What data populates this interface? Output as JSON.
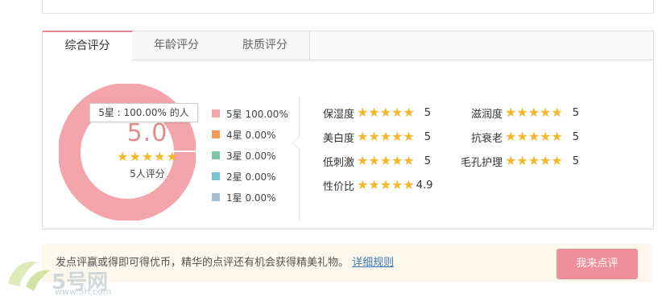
{
  "tabs": [
    {
      "label": "综合评分",
      "active": true
    },
    {
      "label": "年龄评分",
      "active": false
    },
    {
      "label": "肤质评分",
      "active": false
    }
  ],
  "overall": {
    "score": "5.0",
    "people": "5人评分",
    "stars": 5,
    "tooltip": "5星 : 100.00% 的人",
    "ring_color": "#f4a4ab"
  },
  "legend": [
    {
      "label": "5星 100.00%",
      "color": "#f4a4ab"
    },
    {
      "label": "4星 0.00%",
      "color": "#f79a58"
    },
    {
      "label": "3星 0.00%",
      "color": "#7fc6a6"
    },
    {
      "label": "2星 0.00%",
      "color": "#74c4d4"
    },
    {
      "label": "1星 0.00%",
      "color": "#a9bfd6"
    }
  ],
  "attributes": [
    {
      "label": "保湿度",
      "score": "5"
    },
    {
      "label": "滋润度",
      "score": "5"
    },
    {
      "label": "美白度",
      "score": "5"
    },
    {
      "label": "抗衰老",
      "score": "5"
    },
    {
      "label": "低刺激",
      "score": "5"
    },
    {
      "label": "毛孔护理",
      "score": "5"
    },
    {
      "label": "性价比",
      "score": "4.9"
    }
  ],
  "star_color": "#f4b62a",
  "bottom": {
    "text": "发点评赢或得即可得优币，精华的点评还有机会获得精美礼物。",
    "link": "详细规则",
    "button": "我来点评"
  },
  "watermark": {
    "logo_text": "5号网",
    "url": "www.5h.com"
  }
}
